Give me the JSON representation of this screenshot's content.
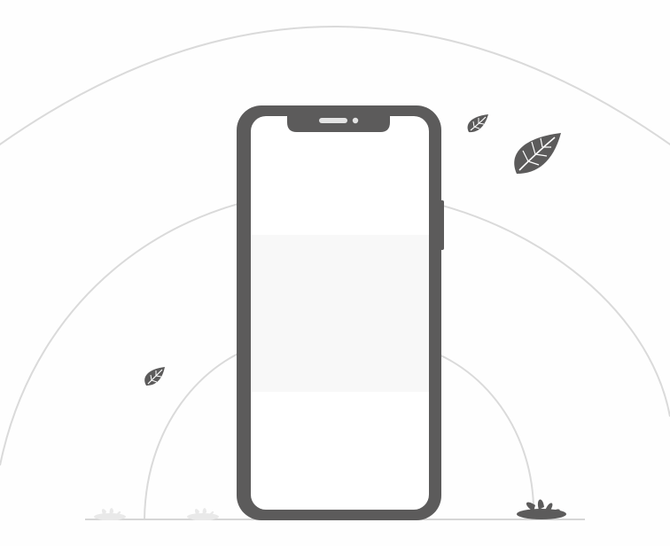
{
  "illustration": {
    "subject": "empty-phone-mockup",
    "colors": {
      "background": "#fefefe",
      "arc_stroke": "#dadada",
      "device_frame": "#5c5b5b",
      "screen": "#ffffff",
      "screen_band": "#f8f8f8",
      "speaker_slot": "#e3e3e3",
      "leaf_fill": "#5c5b5b",
      "leaf_vein": "#ffffff",
      "ground_line": "#c9c9c9",
      "faint_plant": "#e9e9e9"
    },
    "icons": [
      "phone-frame",
      "leaf-icon",
      "plant-icon",
      "speaker-icon",
      "camera-icon"
    ]
  }
}
